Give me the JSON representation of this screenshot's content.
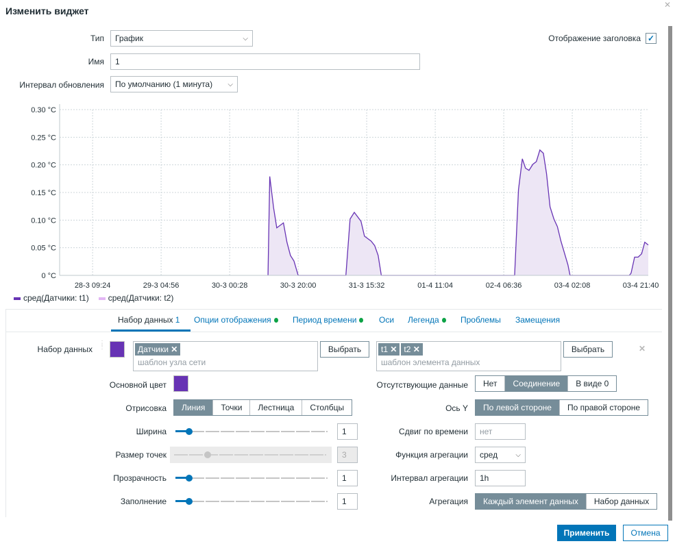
{
  "dialog": {
    "title": "Изменить виджет",
    "close_icon": "close-icon"
  },
  "form": {
    "type_label": "Тип",
    "type_value": "График",
    "name_label": "Имя",
    "name_value": "1",
    "refresh_label": "Интервал обновления",
    "refresh_value": "По умолчанию (1 минута)",
    "show_header_label": "Отображение заголовка",
    "show_header_checked": true
  },
  "chart_data": {
    "type": "area",
    "x_unit": "hours since 28-3 09:24",
    "xlim": [
      -9.4,
      158.4
    ],
    "ylim": [
      0,
      0.3
    ],
    "y_ticks": [
      {
        "v": 0,
        "label": "0 °C"
      },
      {
        "v": 0.05,
        "label": "0.05 °C"
      },
      {
        "v": 0.1,
        "label": "0.10 °C"
      },
      {
        "v": 0.15,
        "label": "0.15 °C"
      },
      {
        "v": 0.2,
        "label": "0.20 °C"
      },
      {
        "v": 0.25,
        "label": "0.25 °C"
      },
      {
        "v": 0.3,
        "label": "0.30 °C"
      }
    ],
    "x_ticks": [
      {
        "v": 0,
        "label": "28-3 09:24"
      },
      {
        "v": 19.53,
        "label": "29-3 04:56"
      },
      {
        "v": 39.07,
        "label": "30-3 00:28"
      },
      {
        "v": 58.6,
        "label": "30-3 20:00"
      },
      {
        "v": 78.13,
        "label": "31-3 15:32"
      },
      {
        "v": 97.67,
        "label": "01-4 11:04"
      },
      {
        "v": 117.2,
        "label": "02-4 06:36"
      },
      {
        "v": 136.73,
        "label": "03-4 02:08"
      },
      {
        "v": 156.27,
        "label": "03-4 21:40"
      }
    ],
    "grid": true,
    "legend_position": "bottom-left",
    "series": [
      {
        "name": "сред(Датчики: t1)",
        "color": "#6733b4",
        "fill": "#ede6f5",
        "x": [
          50.0,
          50.5,
          51.6,
          52.5,
          54.4,
          55.4,
          56.4,
          57.4,
          58.6,
          72.2,
          73.4,
          74.6,
          76.5,
          77.5,
          79.4,
          80.4,
          81.4,
          82.3,
          120.3,
          121.4,
          122.5,
          123.4,
          124.4,
          125.5,
          126.5,
          127.5,
          128.5,
          129.4,
          130.4,
          131.5,
          132.5,
          133.5,
          135.5,
          136.1,
          153.0,
          153.5,
          154.5,
          155.5,
          156.5,
          157.4,
          158.4
        ],
        "y": [
          0,
          0.179,
          0.122,
          0.086,
          0.095,
          0.06,
          0.036,
          0.026,
          0,
          0,
          0.102,
          0.114,
          0.098,
          0.071,
          0.062,
          0.054,
          0.036,
          0,
          0,
          0.155,
          0.211,
          0.194,
          0.19,
          0.201,
          0.206,
          0.227,
          0.221,
          0.184,
          0.124,
          0.102,
          0.088,
          0.062,
          0.019,
          0,
          0,
          0.004,
          0.033,
          0.033,
          0.039,
          0.06,
          0.055
        ]
      },
      {
        "name": "сред(Датчики: t2)",
        "color": "#e2b6f4",
        "x": [],
        "y": []
      }
    ]
  },
  "tabs": [
    {
      "label": "Набор данных",
      "count": "1"
    },
    {
      "label": "Опции отображения"
    },
    {
      "label": "Период времени"
    },
    {
      "label": "Оси"
    },
    {
      "label": "Легенда"
    },
    {
      "label": "Проблемы"
    },
    {
      "label": "Замещения"
    }
  ],
  "dataset": {
    "label": "Набор данных",
    "color": "#6733b4",
    "host_tag": "Датчики",
    "host_placeholder": "шаблон узла сети",
    "item_tags": [
      "t1",
      "t2"
    ],
    "item_placeholder": "шаблон элемента данных",
    "select_label": "Выбрать",
    "base_color_label": "Основной цвет",
    "draw_label": "Отрисовка",
    "draw_options": [
      "Линия",
      "Точки",
      "Лестница",
      "Столбцы"
    ],
    "draw_selected": "Линия",
    "width_label": "Ширина",
    "width_value": "1",
    "point_size_label": "Размер точек",
    "point_size_value": "3",
    "transparency_label": "Прозрачность",
    "transparency_value": "1",
    "fill_label": "Заполнение",
    "fill_value": "1",
    "missing_label": "Отсутствующие данные",
    "missing_options": [
      "Нет",
      "Соединение",
      "В виде 0"
    ],
    "missing_selected": "Соединение",
    "yaxis_label": "Ось Y",
    "yaxis_options": [
      "По левой стороне",
      "По правой стороне"
    ],
    "yaxis_selected": "По левой стороне",
    "timeshift_label": "Сдвиг по времени",
    "timeshift_placeholder": "нет",
    "aggfunc_label": "Функция агрегации",
    "aggfunc_value": "сред",
    "agginterval_label": "Интервал агрегации",
    "agginterval_value": "1h",
    "aggregation_label": "Агрегация",
    "aggregation_options": [
      "Каждый элемент данных",
      "Набор данных"
    ],
    "aggregation_selected": "Каждый элемент данных"
  },
  "footer": {
    "apply": "Применить",
    "cancel": "Отмена"
  }
}
